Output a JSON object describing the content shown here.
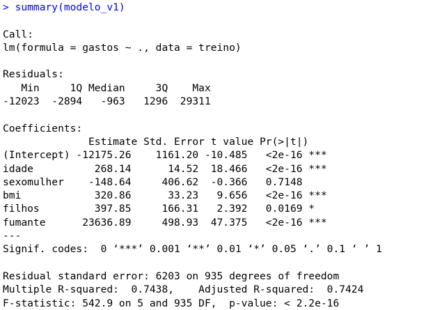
{
  "console": {
    "command": "> summary(modelo_v1)",
    "call_header": "Call:",
    "call_formula": "lm(formula = gastos ~ ., data = treino)",
    "residuals_header": "Residuals:",
    "residuals_labels": "   Min     1Q Median     3Q    Max ",
    "residuals_values": "-12023  -2894   -963   1296  29311 ",
    "coefficients_header": "Coefficients:",
    "coef_columns": "              Estimate Std. Error t value Pr(>|t|)    ",
    "coef_rows": [
      "(Intercept) -12175.26    1161.20 -10.485   <2e-16 ***",
      "idade          268.14      14.52  18.466   <2e-16 ***",
      "sexomulher    -148.64     406.62  -0.366   0.7148    ",
      "bmi            320.86      33.23   9.656   <2e-16 ***",
      "filhos         397.85     166.31   2.392   0.0169 *  ",
      "fumante      23636.89     498.93  47.375   <2e-16 ***"
    ],
    "separator": "---",
    "signif_codes": "Signif. codes:  0 ‘***’ 0.001 ‘**’ 0.01 ‘*’ 0.05 ‘.’ 0.1 ‘ ’ 1",
    "residual_se": "Residual standard error: 6203 on 935 degrees of freedom",
    "r_squared": "Multiple R-squared:  0.7438,    Adjusted R-squared:  0.7424 ",
    "f_statistic": "F-statistic: 542.9 on 5 and 935 DF,  p-value: < 2.2e-16"
  },
  "colors": {
    "command": "#0000ff",
    "output": "#000000",
    "background": "#ffffff"
  }
}
